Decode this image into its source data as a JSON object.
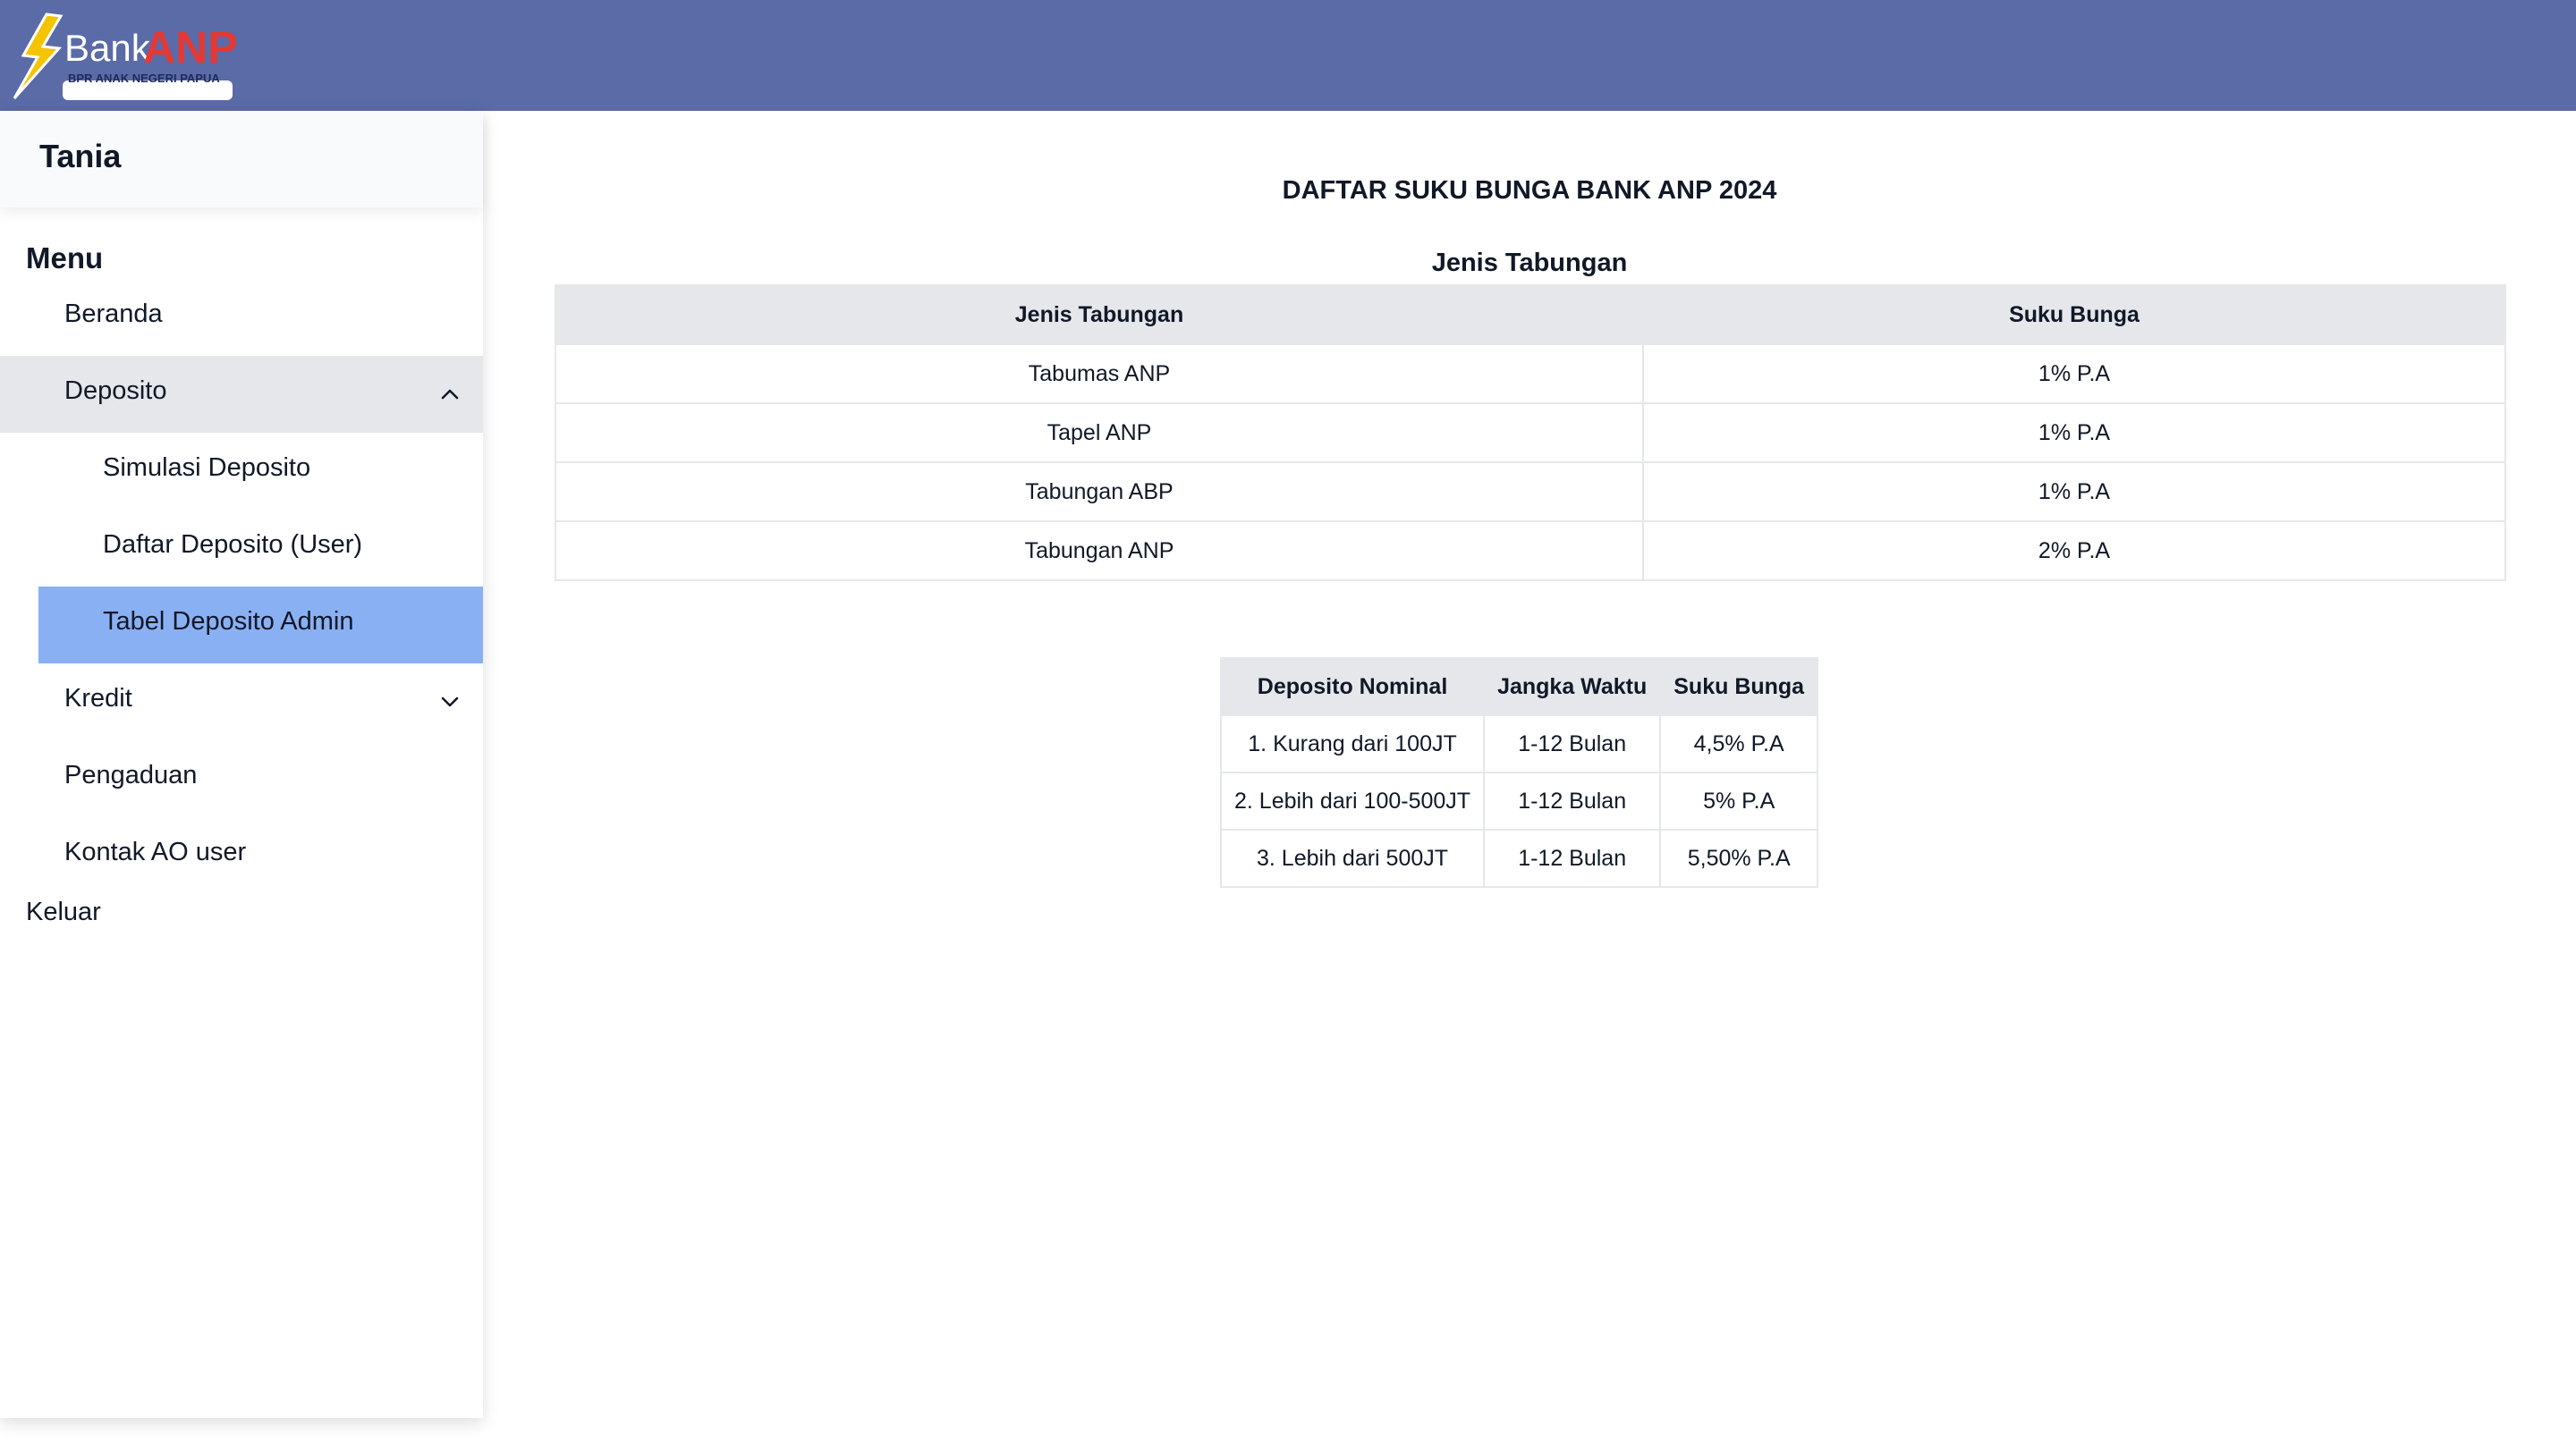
{
  "brand": {
    "logo_word1": "Bank",
    "logo_word2": "ANP",
    "logo_tagline": "BPR ANAK NEGERI PAPUA",
    "header_color": "#5b6ba7"
  },
  "sidebar": {
    "user_name": "Tania",
    "menu_title": "Menu",
    "items": [
      {
        "label": "Beranda"
      },
      {
        "label": "Deposito",
        "icon": "chevron-up-icon"
      },
      {
        "label": "Simulasi Deposito"
      },
      {
        "label": "Daftar Deposito (User)"
      },
      {
        "label": "Tabel Deposito Admin"
      },
      {
        "label": "Kredit",
        "icon": "chevron-down-icon"
      },
      {
        "label": "Pengaduan"
      },
      {
        "label": "Kontak AO user"
      }
    ],
    "logout": "Keluar",
    "active_color": "#8ab0f4"
  },
  "main": {
    "title": "DAFTAR SUKU BUNGA BANK ANP 2024",
    "savings": {
      "caption": "Jenis Tabungan",
      "headers": [
        "Jenis Tabungan",
        "Suku Bunga"
      ],
      "rows": [
        [
          "Tabumas ANP",
          "1% P.A"
        ],
        [
          "Tapel ANP",
          "1% P.A"
        ],
        [
          "Tabungan ABP",
          "1% P.A"
        ],
        [
          "Tabungan ANP",
          "2% P.A"
        ]
      ]
    },
    "deposit": {
      "headers": [
        "Deposito Nominal",
        "Jangka Waktu",
        "Suku Bunga"
      ],
      "rows": [
        [
          "1. Kurang dari 100JT",
          "1-12 Bulan",
          "4,5% P.A"
        ],
        [
          "2. Lebih dari 100-500JT",
          "1-12 Bulan",
          "5% P.A"
        ],
        [
          "3. Lebih dari 500JT",
          "1-12 Bulan",
          "5,50% P.A"
        ]
      ]
    }
  }
}
